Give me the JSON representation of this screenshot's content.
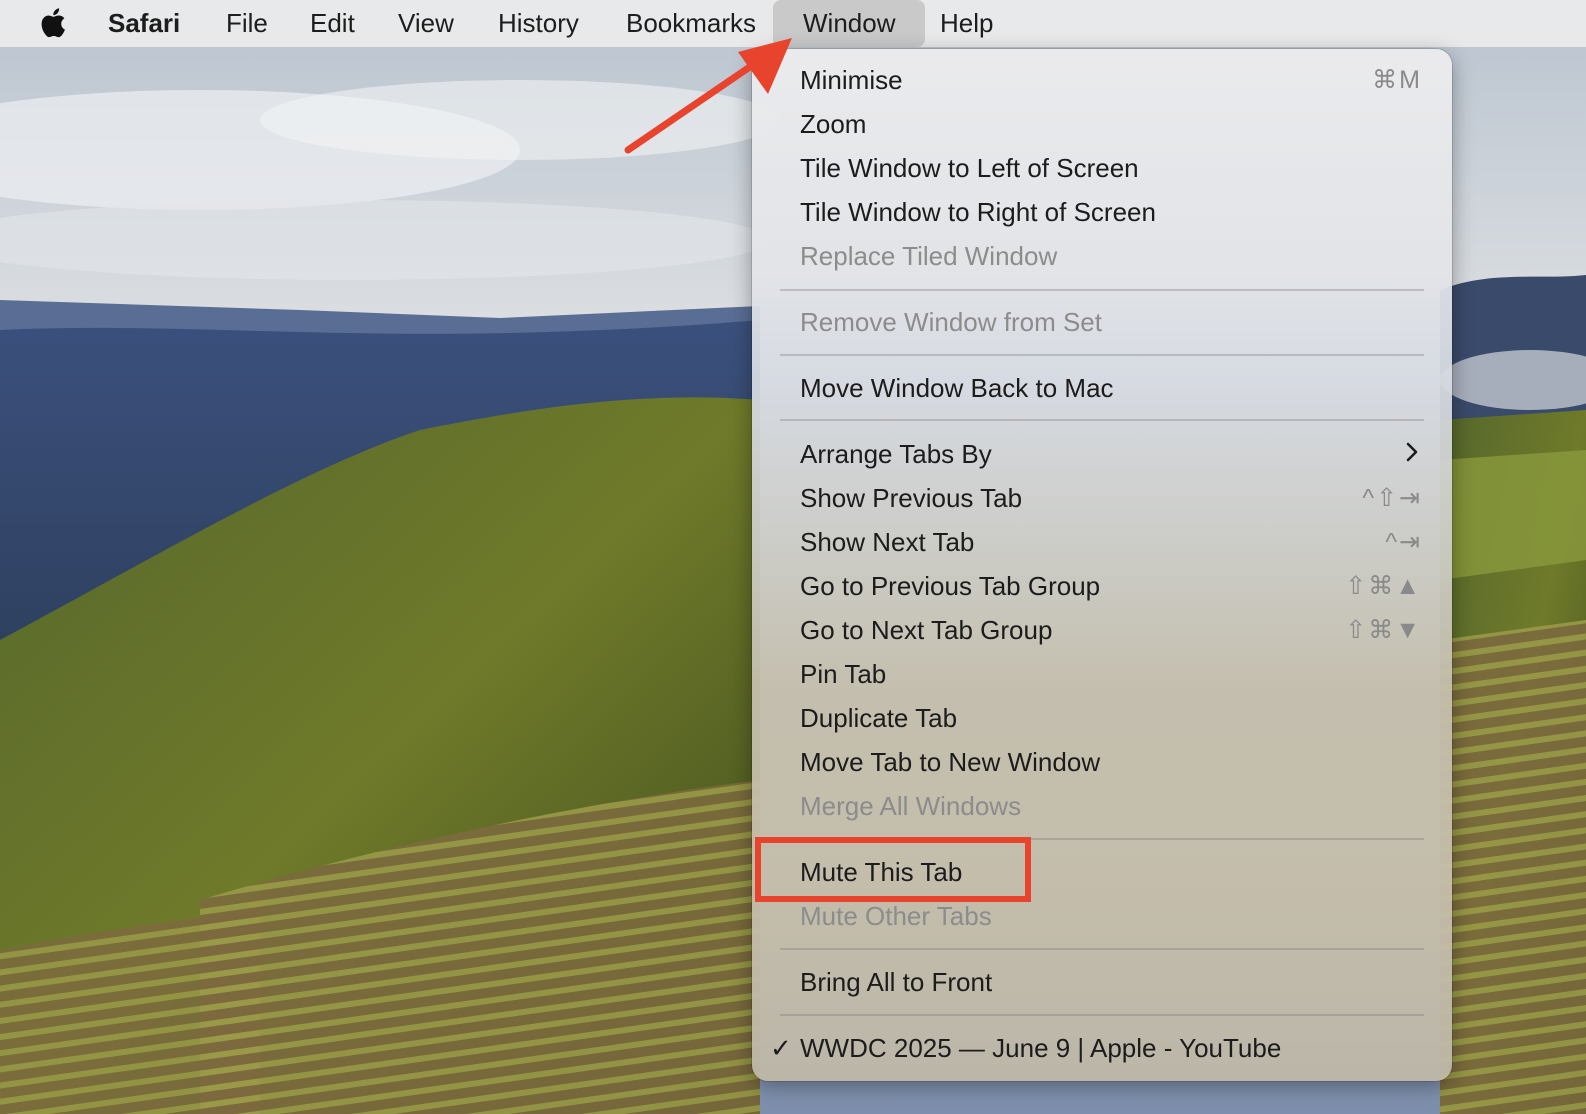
{
  "menubar": {
    "apple_icon": "apple-logo-icon",
    "app_name": "Safari",
    "menus": [
      "File",
      "Edit",
      "View",
      "History",
      "Bookmarks",
      "Window",
      "Help"
    ],
    "active_menu": "Window"
  },
  "dropdown": {
    "items": [
      {
        "label": "Minimise",
        "shortcut": "⌘M",
        "enabled": true
      },
      {
        "label": "Zoom",
        "shortcut": "",
        "enabled": true
      },
      {
        "label": "Tile Window to Left of Screen",
        "shortcut": "",
        "enabled": true
      },
      {
        "label": "Tile Window to Right of Screen",
        "shortcut": "",
        "enabled": true
      },
      {
        "label": "Replace Tiled Window",
        "shortcut": "",
        "enabled": false
      },
      {
        "label": "Remove Window from Set",
        "shortcut": "",
        "enabled": false
      },
      {
        "label": "Move Window Back to Mac",
        "shortcut": "",
        "enabled": true
      },
      {
        "label": "Arrange Tabs By",
        "submenu": true,
        "enabled": true
      },
      {
        "label": "Show Previous Tab",
        "shortcut": "^⇧⇥",
        "enabled": true
      },
      {
        "label": "Show Next Tab",
        "shortcut": "^⇥",
        "enabled": true
      },
      {
        "label": "Go to Previous Tab Group",
        "shortcut": "⇧⌘▲",
        "enabled": true
      },
      {
        "label": "Go to Next Tab Group",
        "shortcut": "⇧⌘▼",
        "enabled": true
      },
      {
        "label": "Pin Tab",
        "shortcut": "",
        "enabled": true
      },
      {
        "label": "Duplicate Tab",
        "shortcut": "",
        "enabled": true
      },
      {
        "label": "Move Tab to New Window",
        "shortcut": "",
        "enabled": true
      },
      {
        "label": "Merge All Windows",
        "shortcut": "",
        "enabled": false
      },
      {
        "label": "Mute This Tab",
        "shortcut": "",
        "enabled": true
      },
      {
        "label": "Mute Other Tabs",
        "shortcut": "",
        "enabled": false
      },
      {
        "label": "Bring All to Front",
        "shortcut": "",
        "enabled": true
      },
      {
        "label": "WWDC 2025 — June 9 | Apple - YouTube",
        "checked": true,
        "enabled": true
      }
    ]
  },
  "annotations": {
    "highlight_color": "#e8432d",
    "highlighted_item": "Mute This Tab",
    "arrow_target": "Window"
  }
}
